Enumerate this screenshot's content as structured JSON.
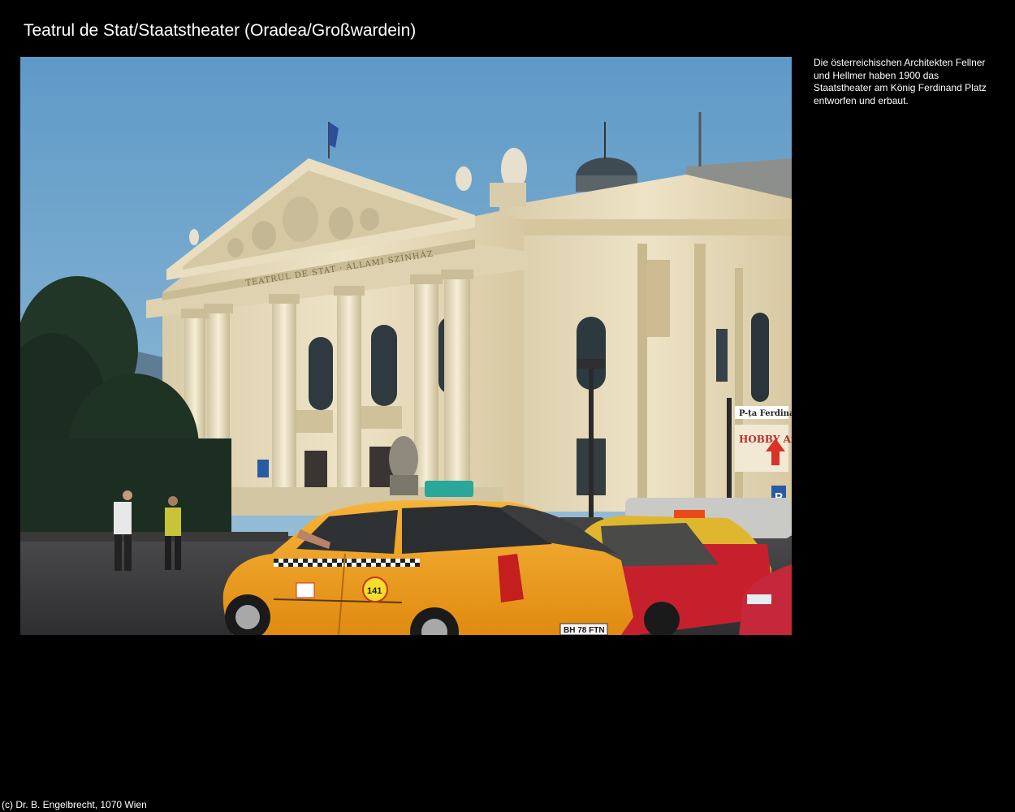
{
  "page": {
    "title": "Teatrul de Stat/Staatstheater (Oradea/Großwardein)",
    "caption": "Die österreichischen Architekten Fellner und Hellmer haben 1900 das Staatstheater am König Ferdinand Platz entworfen und erbaut.",
    "footer": "(c) Dr. B. Engelbrecht, 1070 Wien"
  },
  "photo": {
    "subject": "theatre-facade-with-taxis",
    "pediment_inscription": "TEATRUL DE STAT · ÁLLAMI SZÍNHÁZ",
    "street_sign": "P-ța Ferdinand",
    "shop_sign": "HOBBY Art",
    "taxi_badge": "141",
    "license_plate": "BH 78 FTN"
  },
  "colors": {
    "background": "#000000",
    "text": "#ffffff",
    "sky": "#6fa3c8",
    "facade": "#e7dcbf",
    "taxi": "#f3a51f"
  }
}
